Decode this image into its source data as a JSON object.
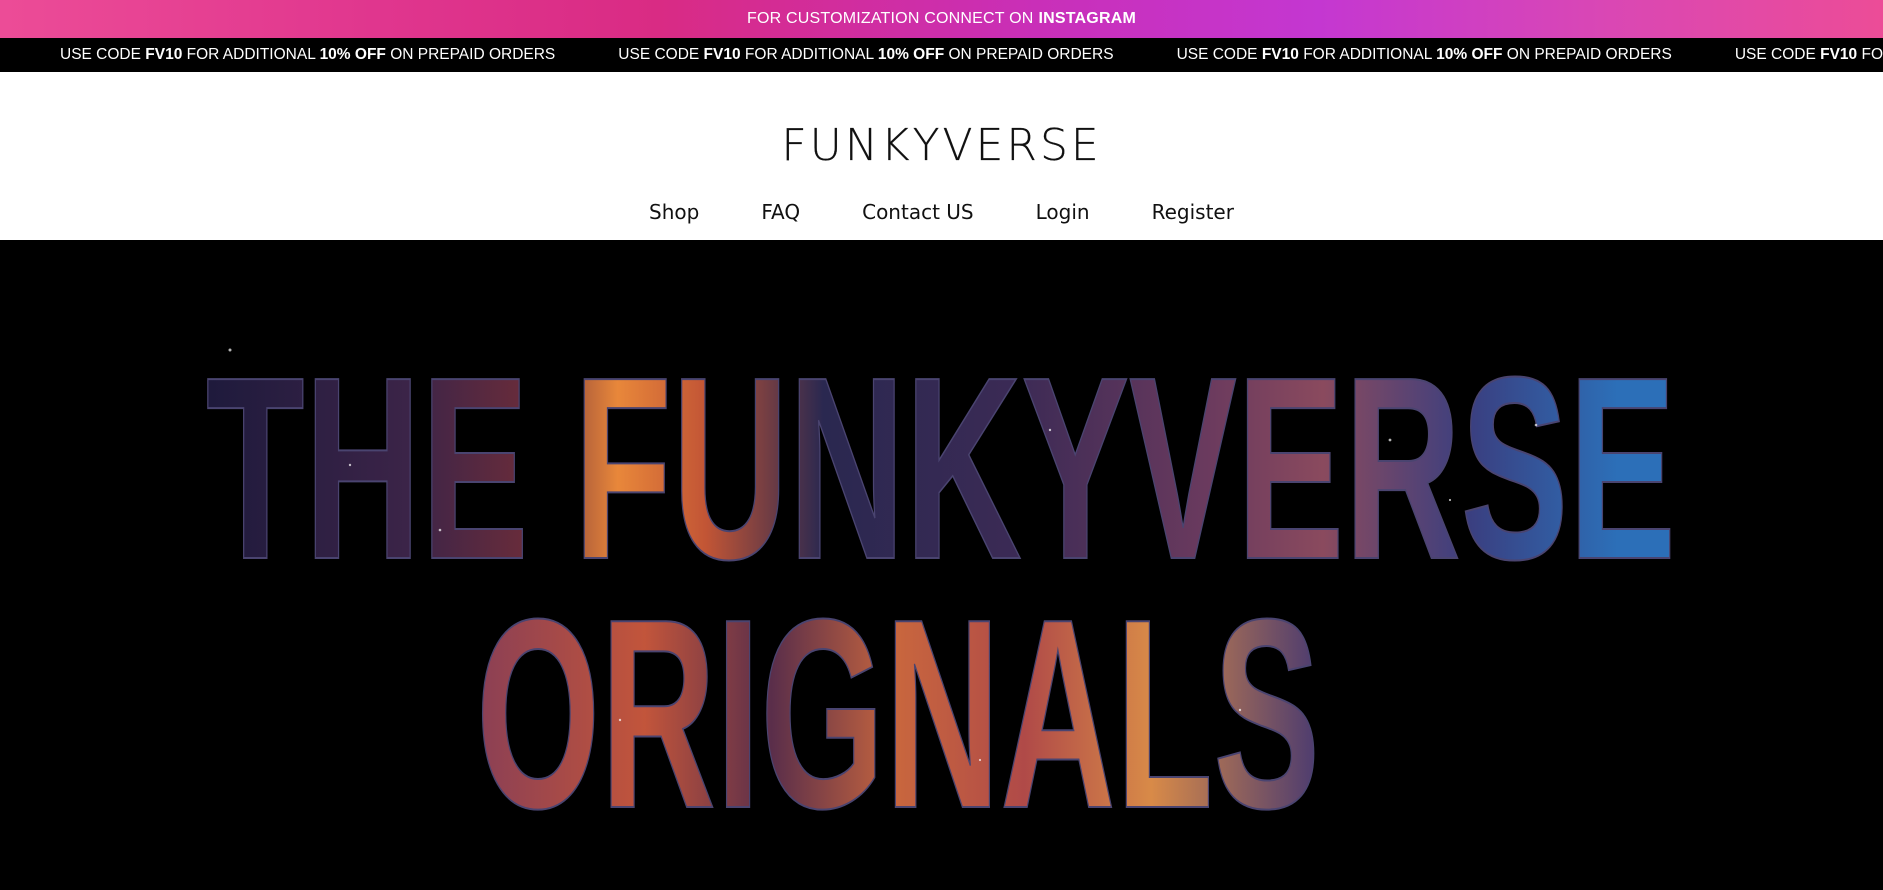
{
  "promo": {
    "text": "FOR CUSTOMIZATION CONNECT ON",
    "link_text": "INSTAGRAM"
  },
  "marquee": {
    "part1": "USE CODE ",
    "code": "FV10",
    "part2": " FOR ADDITIONAL ",
    "discount": "10% OFF",
    "part3": " ON PREPAID ORDERS"
  },
  "header": {
    "logo": "FUNKYVERSE"
  },
  "nav": {
    "shop": "Shop",
    "faq": "FAQ",
    "contact": "Contact US",
    "login": "Login",
    "register": "Register"
  },
  "hero": {
    "line1": "THE FUNKYVERSE",
    "line2": "ORIGNALS"
  },
  "colors": {
    "promo_pink": "#e0368e",
    "promo_purple": "#c437d1",
    "nebula_orange": "#e8873a",
    "nebula_navy": "#2a2850"
  }
}
